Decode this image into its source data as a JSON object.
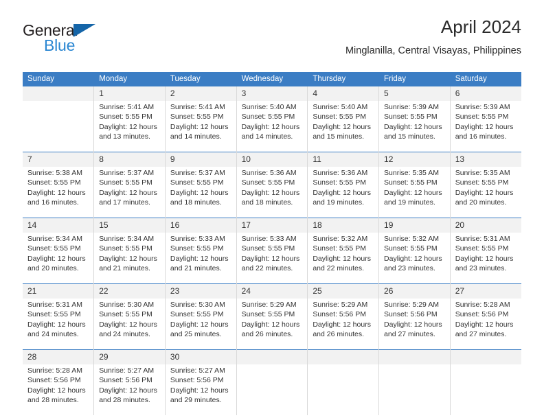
{
  "logo": {
    "word_primary": "General",
    "word_secondary": "Blue",
    "primary_color": "#231f20",
    "secondary_color": "#2b87d2",
    "triangle_color": "#1565a8"
  },
  "header": {
    "title": "April 2024",
    "subtitle": "Minglanilla, Central Visayas, Philippines"
  },
  "theme": {
    "header_bg": "#3b7dc4",
    "daynum_bg": "#f2f2f2",
    "text": "#333333",
    "grid_line": "#d9d9d9"
  },
  "weekdays": [
    "Sunday",
    "Monday",
    "Tuesday",
    "Wednesday",
    "Thursday",
    "Friday",
    "Saturday"
  ],
  "weeks": [
    [
      {
        "day": "",
        "lines": []
      },
      {
        "day": "1",
        "lines": [
          "Sunrise: 5:41 AM",
          "Sunset: 5:55 PM",
          "Daylight: 12 hours",
          "and 13 minutes."
        ]
      },
      {
        "day": "2",
        "lines": [
          "Sunrise: 5:41 AM",
          "Sunset: 5:55 PM",
          "Daylight: 12 hours",
          "and 14 minutes."
        ]
      },
      {
        "day": "3",
        "lines": [
          "Sunrise: 5:40 AM",
          "Sunset: 5:55 PM",
          "Daylight: 12 hours",
          "and 14 minutes."
        ]
      },
      {
        "day": "4",
        "lines": [
          "Sunrise: 5:40 AM",
          "Sunset: 5:55 PM",
          "Daylight: 12 hours",
          "and 15 minutes."
        ]
      },
      {
        "day": "5",
        "lines": [
          "Sunrise: 5:39 AM",
          "Sunset: 5:55 PM",
          "Daylight: 12 hours",
          "and 15 minutes."
        ]
      },
      {
        "day": "6",
        "lines": [
          "Sunrise: 5:39 AM",
          "Sunset: 5:55 PM",
          "Daylight: 12 hours",
          "and 16 minutes."
        ]
      }
    ],
    [
      {
        "day": "7",
        "lines": [
          "Sunrise: 5:38 AM",
          "Sunset: 5:55 PM",
          "Daylight: 12 hours",
          "and 16 minutes."
        ]
      },
      {
        "day": "8",
        "lines": [
          "Sunrise: 5:37 AM",
          "Sunset: 5:55 PM",
          "Daylight: 12 hours",
          "and 17 minutes."
        ]
      },
      {
        "day": "9",
        "lines": [
          "Sunrise: 5:37 AM",
          "Sunset: 5:55 PM",
          "Daylight: 12 hours",
          "and 18 minutes."
        ]
      },
      {
        "day": "10",
        "lines": [
          "Sunrise: 5:36 AM",
          "Sunset: 5:55 PM",
          "Daylight: 12 hours",
          "and 18 minutes."
        ]
      },
      {
        "day": "11",
        "lines": [
          "Sunrise: 5:36 AM",
          "Sunset: 5:55 PM",
          "Daylight: 12 hours",
          "and 19 minutes."
        ]
      },
      {
        "day": "12",
        "lines": [
          "Sunrise: 5:35 AM",
          "Sunset: 5:55 PM",
          "Daylight: 12 hours",
          "and 19 minutes."
        ]
      },
      {
        "day": "13",
        "lines": [
          "Sunrise: 5:35 AM",
          "Sunset: 5:55 PM",
          "Daylight: 12 hours",
          "and 20 minutes."
        ]
      }
    ],
    [
      {
        "day": "14",
        "lines": [
          "Sunrise: 5:34 AM",
          "Sunset: 5:55 PM",
          "Daylight: 12 hours",
          "and 20 minutes."
        ]
      },
      {
        "day": "15",
        "lines": [
          "Sunrise: 5:34 AM",
          "Sunset: 5:55 PM",
          "Daylight: 12 hours",
          "and 21 minutes."
        ]
      },
      {
        "day": "16",
        "lines": [
          "Sunrise: 5:33 AM",
          "Sunset: 5:55 PM",
          "Daylight: 12 hours",
          "and 21 minutes."
        ]
      },
      {
        "day": "17",
        "lines": [
          "Sunrise: 5:33 AM",
          "Sunset: 5:55 PM",
          "Daylight: 12 hours",
          "and 22 minutes."
        ]
      },
      {
        "day": "18",
        "lines": [
          "Sunrise: 5:32 AM",
          "Sunset: 5:55 PM",
          "Daylight: 12 hours",
          "and 22 minutes."
        ]
      },
      {
        "day": "19",
        "lines": [
          "Sunrise: 5:32 AM",
          "Sunset: 5:55 PM",
          "Daylight: 12 hours",
          "and 23 minutes."
        ]
      },
      {
        "day": "20",
        "lines": [
          "Sunrise: 5:31 AM",
          "Sunset: 5:55 PM",
          "Daylight: 12 hours",
          "and 23 minutes."
        ]
      }
    ],
    [
      {
        "day": "21",
        "lines": [
          "Sunrise: 5:31 AM",
          "Sunset: 5:55 PM",
          "Daylight: 12 hours",
          "and 24 minutes."
        ]
      },
      {
        "day": "22",
        "lines": [
          "Sunrise: 5:30 AM",
          "Sunset: 5:55 PM",
          "Daylight: 12 hours",
          "and 24 minutes."
        ]
      },
      {
        "day": "23",
        "lines": [
          "Sunrise: 5:30 AM",
          "Sunset: 5:55 PM",
          "Daylight: 12 hours",
          "and 25 minutes."
        ]
      },
      {
        "day": "24",
        "lines": [
          "Sunrise: 5:29 AM",
          "Sunset: 5:55 PM",
          "Daylight: 12 hours",
          "and 26 minutes."
        ]
      },
      {
        "day": "25",
        "lines": [
          "Sunrise: 5:29 AM",
          "Sunset: 5:56 PM",
          "Daylight: 12 hours",
          "and 26 minutes."
        ]
      },
      {
        "day": "26",
        "lines": [
          "Sunrise: 5:29 AM",
          "Sunset: 5:56 PM",
          "Daylight: 12 hours",
          "and 27 minutes."
        ]
      },
      {
        "day": "27",
        "lines": [
          "Sunrise: 5:28 AM",
          "Sunset: 5:56 PM",
          "Daylight: 12 hours",
          "and 27 minutes."
        ]
      }
    ],
    [
      {
        "day": "28",
        "lines": [
          "Sunrise: 5:28 AM",
          "Sunset: 5:56 PM",
          "Daylight: 12 hours",
          "and 28 minutes."
        ]
      },
      {
        "day": "29",
        "lines": [
          "Sunrise: 5:27 AM",
          "Sunset: 5:56 PM",
          "Daylight: 12 hours",
          "and 28 minutes."
        ]
      },
      {
        "day": "30",
        "lines": [
          "Sunrise: 5:27 AM",
          "Sunset: 5:56 PM",
          "Daylight: 12 hours",
          "and 29 minutes."
        ]
      },
      {
        "day": "",
        "lines": []
      },
      {
        "day": "",
        "lines": []
      },
      {
        "day": "",
        "lines": []
      },
      {
        "day": "",
        "lines": []
      }
    ]
  ]
}
